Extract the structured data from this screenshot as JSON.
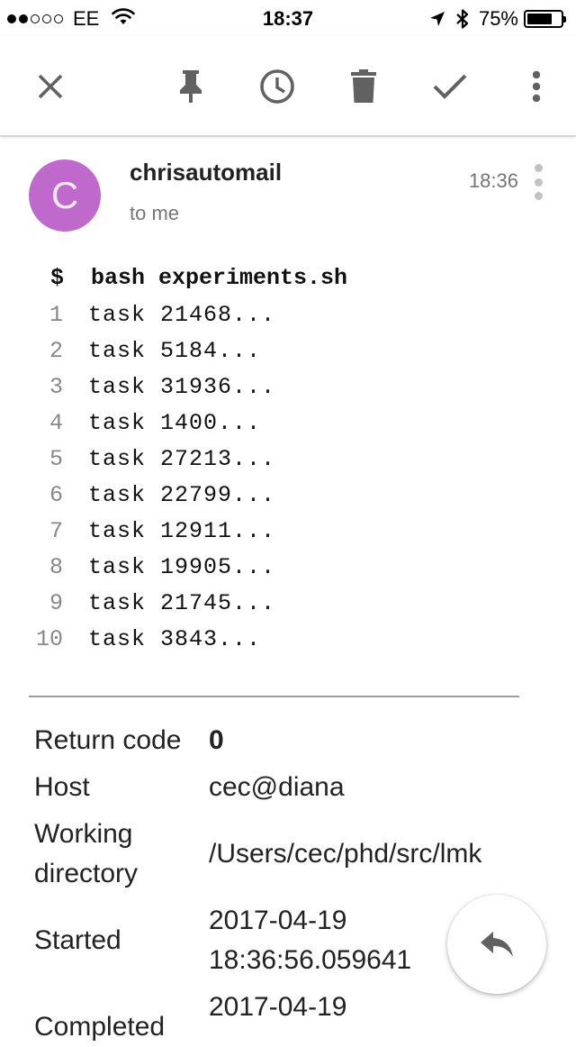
{
  "status_bar": {
    "signal_strength": 2,
    "signal_max": 5,
    "carrier": "EE",
    "time": "18:37",
    "battery_percent": "75%",
    "battery_level": 0.75,
    "icons": [
      "wifi-icon",
      "location-arrow-icon",
      "bluetooth-icon",
      "battery-icon"
    ]
  },
  "toolbar": {
    "buttons": [
      "close-icon",
      "pin-icon",
      "snooze-clock-icon",
      "trash-icon",
      "done-check-icon",
      "more-vert-icon"
    ]
  },
  "message": {
    "avatar_letter": "C",
    "avatar_color": "#bf69cc",
    "sender": "chrisautomail",
    "recipient": "to me",
    "time": "18:36"
  },
  "code": {
    "command": "$  bash experiments.sh",
    "lines": [
      {
        "num": "1",
        "text": "task 21468..."
      },
      {
        "num": "2",
        "text": "task 5184..."
      },
      {
        "num": "3",
        "text": "task 31936..."
      },
      {
        "num": "4",
        "text": "task 1400..."
      },
      {
        "num": "5",
        "text": "task 27213..."
      },
      {
        "num": "6",
        "text": "task 22799..."
      },
      {
        "num": "7",
        "text": "task 12911..."
      },
      {
        "num": "8",
        "text": "task 19905..."
      },
      {
        "num": "9",
        "text": "task 21745..."
      },
      {
        "num": "10",
        "text": "task 3843..."
      }
    ]
  },
  "info": {
    "return_code_label": "Return code",
    "return_code_value": "0",
    "host_label": "Host",
    "host_value": "cec@diana",
    "wd_label_1": "Working",
    "wd_label_2": "directory",
    "wd_value": "/Users/cec/phd/src/lmk",
    "started_label": "Started",
    "started_value_1": "2017-04-19",
    "started_value_2": "18:36:56.059641",
    "completed_label": "Completed",
    "completed_value_1": "2017-04-19"
  },
  "fab": {
    "icon": "reply-icon"
  }
}
